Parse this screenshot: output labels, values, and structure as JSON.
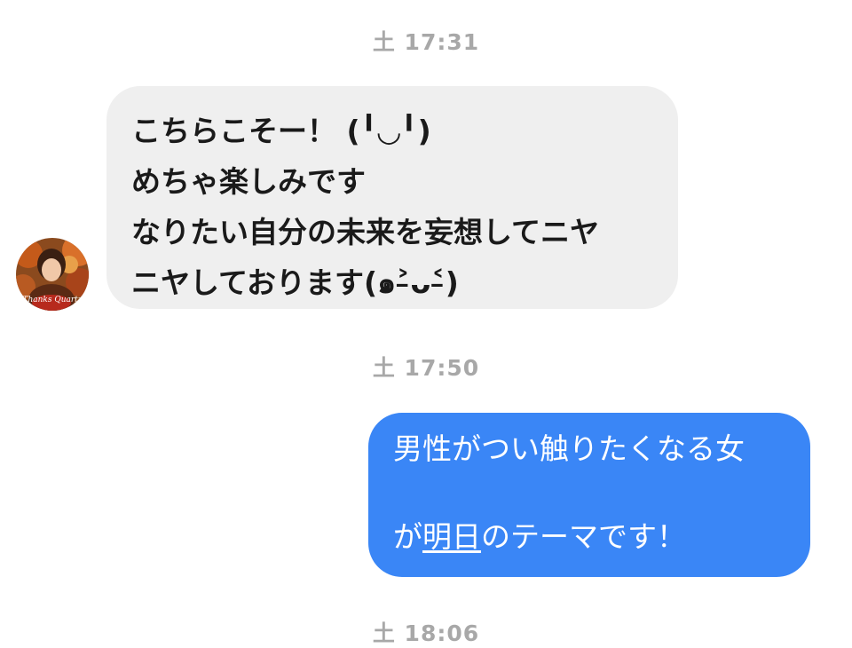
{
  "timestamps": [
    "土 17:31",
    "土 17:50",
    "土 18:06"
  ],
  "incoming_message": {
    "lines": [
      "こちらこそー！ (╹◡╹)",
      "めちゃ楽しみです",
      "なりたい自分の未来を妄想してニヤ",
      "ニヤしております(๑˃̵ᴗ˂̵)"
    ]
  },
  "avatar": {
    "badge_text": "Thanks Quartz"
  },
  "outgoing_message": {
    "line1": "男性がつい触りたくなる女",
    "line2_before": "が",
    "line2_link": "明日",
    "line2_after": "のテーマです！"
  },
  "colors": {
    "incoming_bubble": "#efefef",
    "outgoing_bubble": "#3a86f6",
    "timestamp": "#a8a8a8"
  }
}
